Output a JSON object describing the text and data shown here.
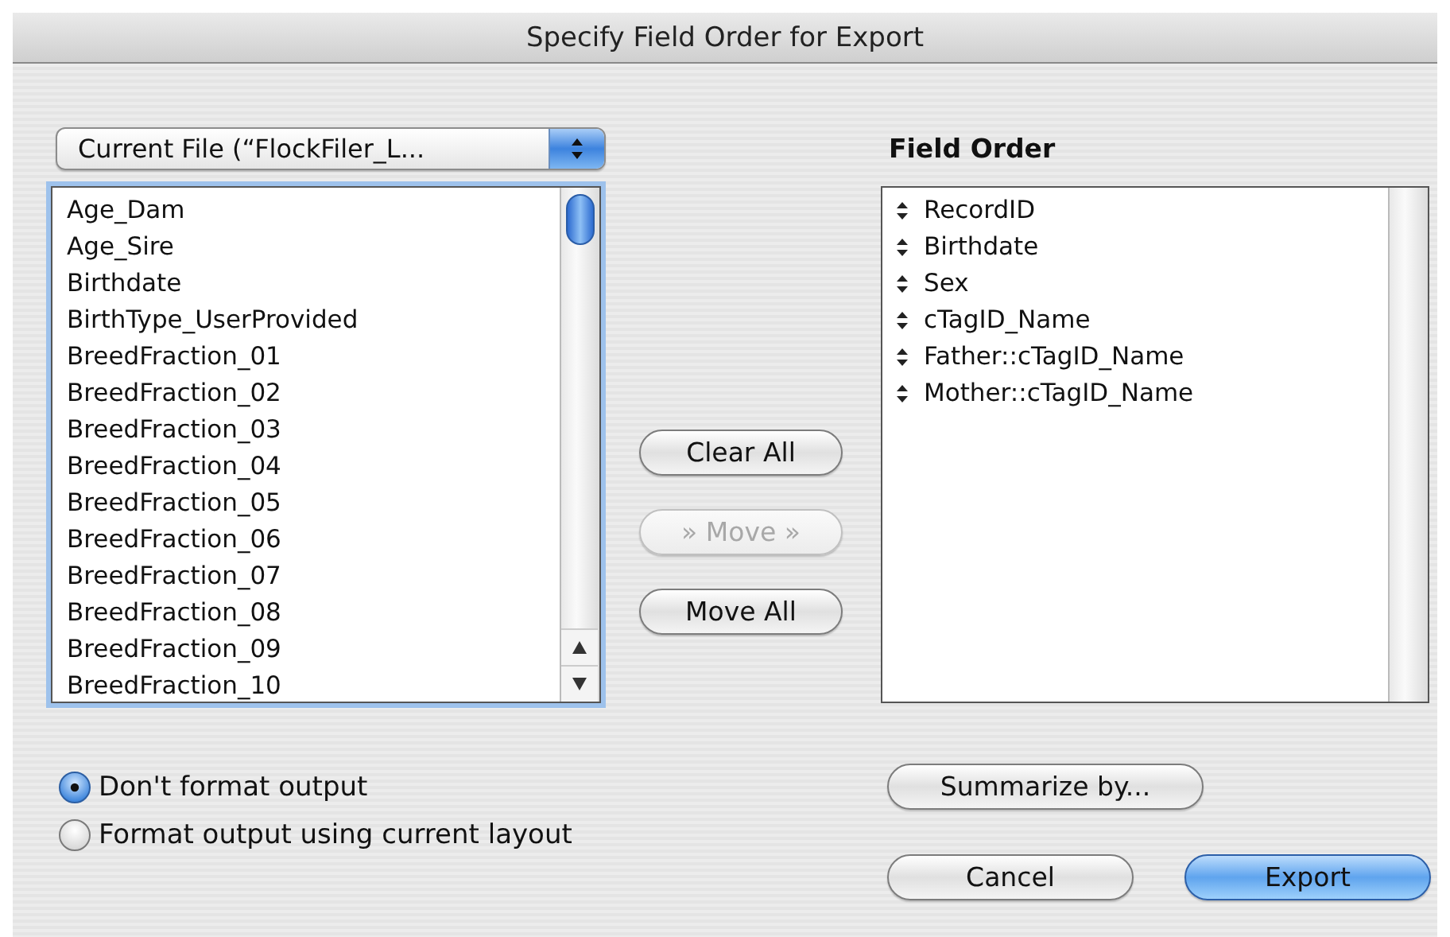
{
  "window": {
    "title": "Specify Field Order for Export"
  },
  "source_popup": {
    "value": "Current File (“FlockFiler_L..."
  },
  "available_fields": [
    "Age_Dam",
    "Age_Sire",
    "Birthdate",
    "BirthType_UserProvided",
    "BreedFraction_01",
    "BreedFraction_02",
    "BreedFraction_03",
    "BreedFraction_04",
    "BreedFraction_05",
    "BreedFraction_06",
    "BreedFraction_07",
    "BreedFraction_08",
    "BreedFraction_09",
    "BreedFraction_10"
  ],
  "move_buttons": [
    {
      "label": "Clear All",
      "disabled": false
    },
    {
      "label": "» Move »",
      "disabled": true
    },
    {
      "label": "Move All",
      "disabled": false
    }
  ],
  "field_order": {
    "heading": "Field Order",
    "items": [
      "RecordID",
      "Birthdate",
      "Sex",
      "cTagID_Name",
      "Father::cTagID_Name",
      "Mother::cTagID_Name"
    ]
  },
  "output_options": [
    {
      "label": "Don't format output",
      "selected": true
    },
    {
      "label": "Format output using current layout",
      "selected": false
    }
  ],
  "summarize_button": {
    "label": "Summarize by..."
  },
  "dialog_buttons": [
    {
      "label": "Cancel",
      "default": false
    },
    {
      "label": "Export",
      "default": true
    }
  ]
}
